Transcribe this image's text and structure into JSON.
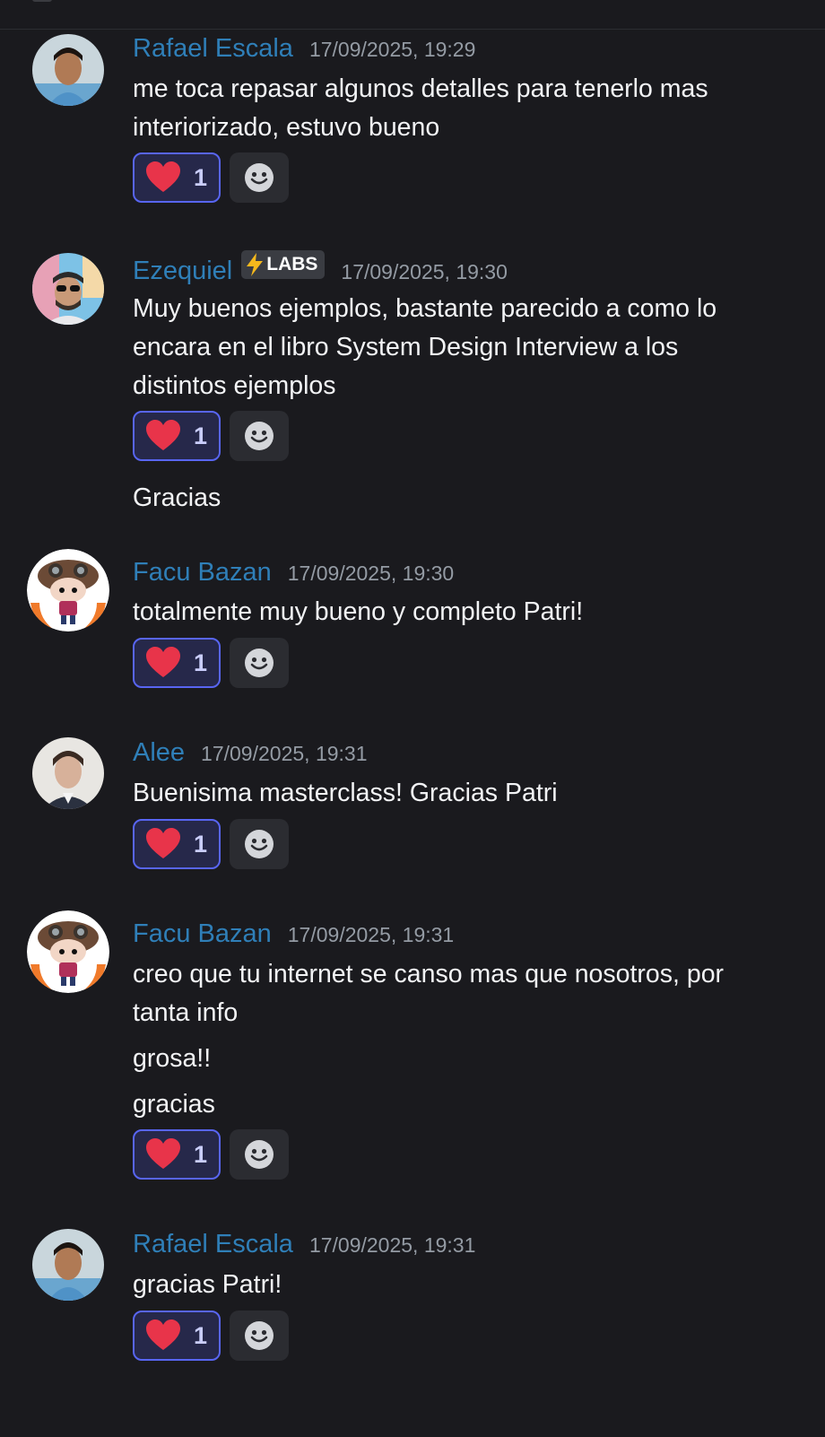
{
  "messages": [
    {
      "author": "Rafael Escala",
      "timestamp": "17/09/2025, 19:29",
      "lines": [
        "me toca repasar algunos detalles para tenerlo mas",
        "interiorizado, estuvo bueno"
      ],
      "reaction_count": "1"
    },
    {
      "author": "Ezequiel",
      "badge": "LABS",
      "timestamp": "17/09/2025, 19:30",
      "lines": [
        "Muy buenos ejemplos, bastante parecido a como lo",
        "encara en el libro System Design Interview a los",
        "distintos ejemplos"
      ],
      "reaction_count": "1",
      "followup": "Gracias"
    },
    {
      "author": "Facu Bazan",
      "timestamp": "17/09/2025, 19:30",
      "lines": [
        "totalmente muy bueno y completo Patri!"
      ],
      "reaction_count": "1"
    },
    {
      "author": "Alee",
      "timestamp": "17/09/2025, 19:31",
      "lines": [
        "Buenisima masterclass! Gracias Patri"
      ],
      "reaction_count": "1"
    },
    {
      "author": "Facu Bazan",
      "timestamp": "17/09/2025, 19:31",
      "lines": [
        "creo que tu internet se canso mas que nosotros, por",
        "tanta info"
      ],
      "extra_lines": [
        "grosa!!",
        "gracias"
      ],
      "reaction_count": "1"
    },
    {
      "author": "Rafael Escala",
      "timestamp": "17/09/2025, 19:31",
      "lines": [
        "gracias Patri!"
      ],
      "reaction_count": "1"
    }
  ],
  "colors": {
    "background": "#1a1a1e",
    "username": "#2f7fb8",
    "timestamp": "#949ba4",
    "reaction_border": "#5865f2",
    "heart": "#e8344a"
  },
  "icons": [
    "heart-icon",
    "add-reaction-icon",
    "lightning-icon"
  ]
}
